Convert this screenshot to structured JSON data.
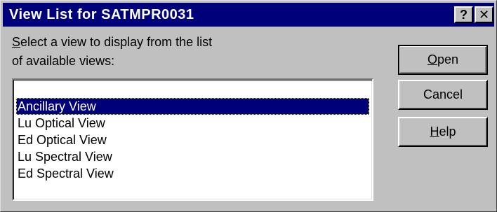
{
  "window": {
    "title": "View List for SATMPR0031",
    "help_glyph": "?",
    "close_glyph": "✕"
  },
  "prompt": {
    "mnemonic": "S",
    "line1_rest": "elect a view to display from the list",
    "line2": "of available views:"
  },
  "views": {
    "items": [
      {
        "label": "Ancillary View",
        "selected": true
      },
      {
        "label": "Lu Optical View",
        "selected": false
      },
      {
        "label": "Ed Optical View",
        "selected": false
      },
      {
        "label": "Lu Spectral View",
        "selected": false
      },
      {
        "label": "Ed Spectral View",
        "selected": false
      }
    ]
  },
  "buttons": {
    "open": {
      "mnemonic": "O",
      "rest": "pen"
    },
    "cancel": {
      "label": "Cancel"
    },
    "help": {
      "mnemonic": "H",
      "rest": "elp"
    }
  },
  "colors": {
    "titlebar": "#00007b",
    "face": "#c0c0c0",
    "selection": "#00007b"
  }
}
